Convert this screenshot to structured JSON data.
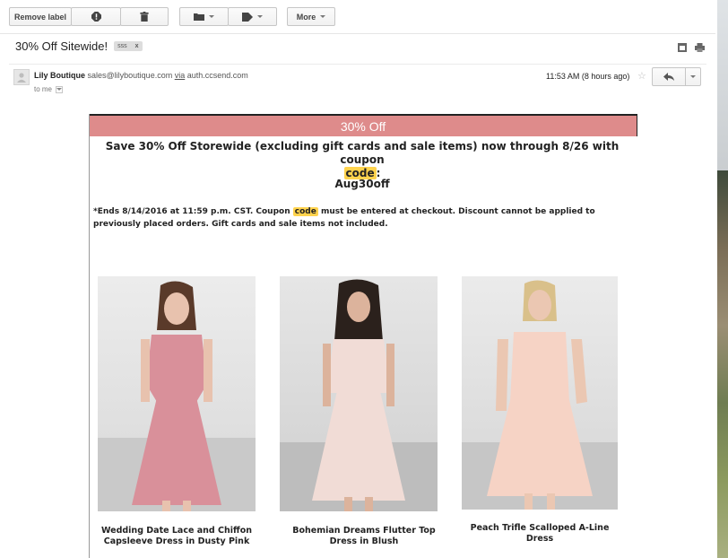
{
  "toolbar": {
    "remove_label": "Remove label",
    "more_label": "More"
  },
  "email": {
    "subject": "30% Off Sitewide!",
    "label_chip": "sss",
    "label_chip_close": "x",
    "sender_name": "Lily Boutique",
    "sender_email": "sales@lilyboutique.com",
    "via_label": "via",
    "via_domain": "auth.ccsend.com",
    "to_me": "to me",
    "time": "11:53 AM (8 hours ago)"
  },
  "body": {
    "banner": "30% Off",
    "headline_pre": "Save 30% Off Storewide (excluding gift cards and sale items) now through 8/26 with coupon",
    "headline_code": "code",
    "headline_post": ":",
    "coupon_code": "Aug30off",
    "fine_pre": "*Ends 8/14/2016 at 11:59 p.m. CST. Coupon",
    "fine_code": "code",
    "fine_post": "must be entered at checkout. Discount cannot be applied to previously placed orders. Gift cards and sale items not included."
  },
  "products": [
    {
      "name": "Wedding Date Lace and Chiffon Capsleeve Dress in Dusty Pink",
      "color": "#d9909a"
    },
    {
      "name": "Bohemian Dreams Flutter Top Dress in Blush",
      "color": "#f1dcd6"
    },
    {
      "name": "Peach Trifle Scalloped A-Line Dress",
      "color": "#f6d3c5"
    }
  ],
  "colors": {
    "banner": "#de8b8b",
    "highlight": "#ffd34e"
  }
}
